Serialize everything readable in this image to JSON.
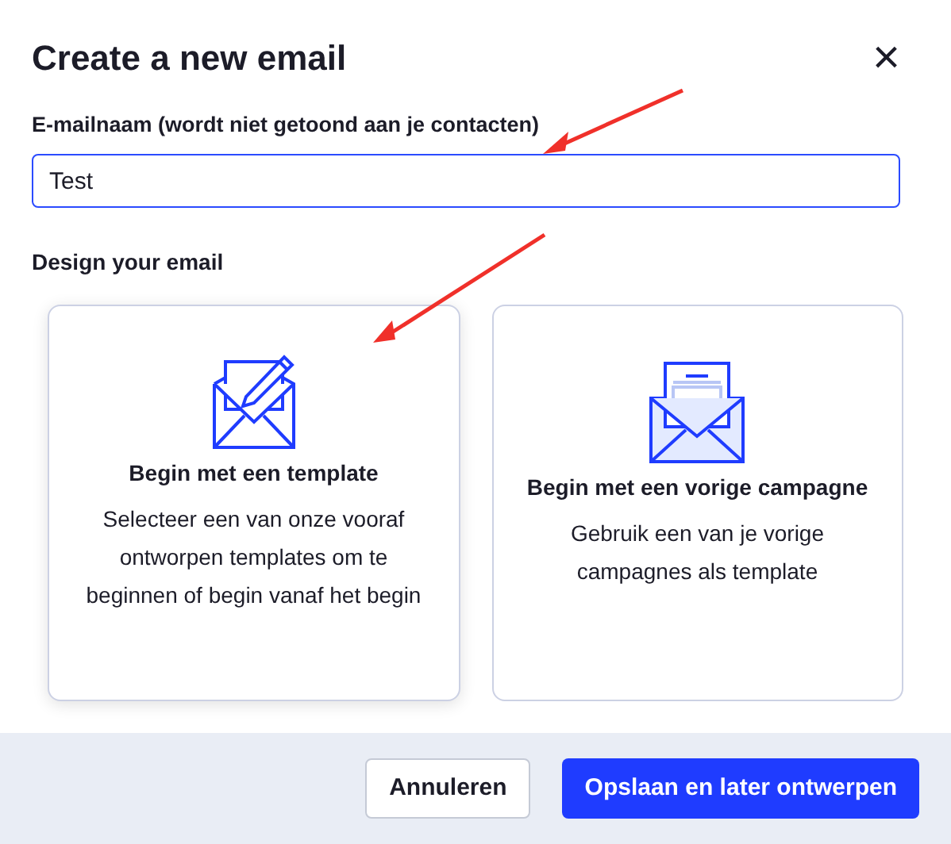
{
  "dialog": {
    "title": "Create a new email",
    "close": "×"
  },
  "name_field": {
    "label": "E-mailnaam (wordt niet getoond aan je contacten)",
    "value": "Test",
    "focused": true
  },
  "design": {
    "heading": "Design your email",
    "options": [
      {
        "kind": "template",
        "title": "Begin met een template",
        "description": "Selecteer een van onze vooraf ontworpen templates om te beginnen of begin vanaf het begin",
        "selected": true
      },
      {
        "kind": "campaign",
        "title": "Begin met een vorige campagne",
        "description": "Gebruik een van je vorige campagnes als template",
        "selected": false
      }
    ]
  },
  "footer": {
    "buttons": [
      {
        "label": "Annuleren",
        "kind": "secondary"
      },
      {
        "label": "Opslaan en later ontwerpen",
        "kind": "primary"
      }
    ]
  }
}
